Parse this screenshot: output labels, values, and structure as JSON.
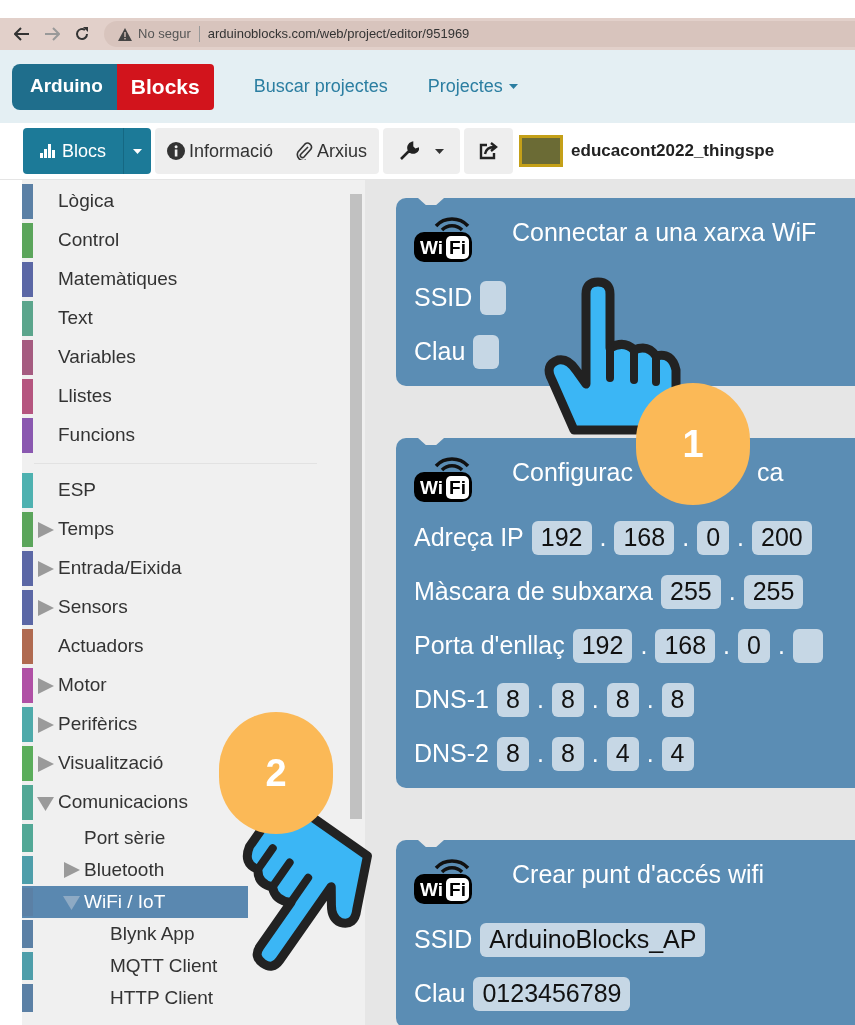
{
  "browser": {
    "security": "No segur",
    "url": "arduinoblocks.com/web/project/editor/951969"
  },
  "header": {
    "logo": {
      "left": "Arduino",
      "right": "Blocks"
    },
    "nav": [
      {
        "label": "Buscar projectes",
        "dropdown": false
      },
      {
        "label": "Projectes",
        "dropdown": true
      }
    ]
  },
  "toolbar": {
    "blocks_button": "Blocs",
    "buttons": [
      {
        "kind": "info",
        "label": "Informació"
      },
      {
        "kind": "files",
        "label": "Arxius"
      }
    ],
    "project_title": "educacont2022_thingspe"
  },
  "sidebar": {
    "items": [
      {
        "kind": "item",
        "label": "Lògica",
        "color": "#5b80a5",
        "selected": false
      },
      {
        "kind": "item",
        "label": "Control",
        "color": "#5ba55b",
        "selected": false
      },
      {
        "kind": "item",
        "label": "Matemàtiques",
        "color": "#5b67a5",
        "selected": false
      },
      {
        "kind": "item",
        "label": "Text",
        "color": "#5ba58c",
        "selected": false
      },
      {
        "kind": "item",
        "label": "Variables",
        "color": "#a55b80",
        "selected": false
      },
      {
        "kind": "item",
        "label": "Llistes",
        "color": "#b5557f",
        "selected": false
      },
      {
        "kind": "item",
        "label": "Funcions",
        "color": "#8a58b0",
        "selected": false
      },
      {
        "kind": "separator"
      },
      {
        "kind": "item",
        "label": "ESP",
        "color": "#4eb1b0",
        "selected": false
      },
      {
        "kind": "folder",
        "label": "Temps",
        "color": "#5ba55b",
        "selected": false,
        "expanded": false
      },
      {
        "kind": "folder",
        "label": "Entrada/Eixida",
        "color": "#5b67a5",
        "selected": false,
        "expanded": false
      },
      {
        "kind": "folder",
        "label": "Sensors",
        "color": "#5b67a5",
        "selected": false,
        "expanded": false
      },
      {
        "kind": "item",
        "label": "Actuadors",
        "color": "#b06a50",
        "selected": false
      },
      {
        "kind": "folder",
        "label": "Motor",
        "color": "#b050a5",
        "selected": false,
        "expanded": false
      },
      {
        "kind": "folder",
        "label": "Perifèrics",
        "color": "#4eaaaa",
        "selected": false,
        "expanded": false
      },
      {
        "kind": "folder",
        "label": "Visualització",
        "color": "#5bad5b",
        "selected": false,
        "expanded": false
      },
      {
        "kind": "folder",
        "label": "Comunicacions",
        "color": "#52a896",
        "selected": false,
        "expanded": true,
        "children": [
          {
            "kind": "item",
            "label": "Port sèrie",
            "color": "#52a896",
            "selected": false
          },
          {
            "kind": "folder",
            "label": "Bluetooth",
            "color": "#4e9eaa",
            "selected": false,
            "expanded": false
          },
          {
            "kind": "folder",
            "label": "WiFi / IoT",
            "color": "#5b80a5",
            "selected": true,
            "expanded": true,
            "children": [
              {
                "kind": "item",
                "label": "Blynk App",
                "color": "#5b80a5",
                "selected": false
              },
              {
                "kind": "item",
                "label": "MQTT Client",
                "color": "#4e9eaa",
                "selected": false
              },
              {
                "kind": "item",
                "label": "HTTP Client",
                "color": "#5b80a5",
                "selected": false
              }
            ]
          }
        ]
      }
    ]
  },
  "blocks": [
    {
      "icon": {
        "left": "Wi",
        "right": "Fi"
      },
      "title": [
        "Connectar a una xarxa WiF"
      ],
      "rows": [
        {
          "kind": "text",
          "label": "SSID"
        },
        {
          "kind": "text",
          "label": "Clau"
        }
      ]
    },
    {
      "icon": {
        "left": "Wi",
        "right": "Fi"
      },
      "title": [
        "Configurac",
        "ca"
      ],
      "rows": [
        {
          "kind": "ip",
          "label": "Adreça IP",
          "separator": ".",
          "octets": [
            "192",
            "168",
            "0",
            "200"
          ],
          "trailing": false
        },
        {
          "kind": "ip",
          "label": "Màscara de subxarxa",
          "separator": ".",
          "octets": [
            "255",
            "255"
          ],
          "trailing": false
        },
        {
          "kind": "ip",
          "label": "Porta d'enllaç",
          "separator": ".",
          "octets": [
            "192",
            "168",
            "0"
          ],
          "trailing": true
        },
        {
          "kind": "ip",
          "label": "DNS-1",
          "separator": ".",
          "octets": [
            "8",
            "8",
            "8",
            "8"
          ],
          "trailing": false
        },
        {
          "kind": "ip",
          "label": "DNS-2",
          "separator": ".",
          "octets": [
            "8",
            "8",
            "4",
            "4"
          ],
          "trailing": false
        }
      ]
    },
    {
      "icon": {
        "left": "Wi",
        "right": "Fi"
      },
      "title": [
        "Crear punt d'accés wifi"
      ],
      "rows": [
        {
          "kind": "text",
          "label": "SSID",
          "value": "ArduinoBlocks_AP"
        },
        {
          "kind": "text",
          "label": "Clau",
          "value": "0123456789"
        }
      ]
    }
  ],
  "callouts": [
    {
      "number": "1"
    },
    {
      "number": "2"
    }
  ]
}
